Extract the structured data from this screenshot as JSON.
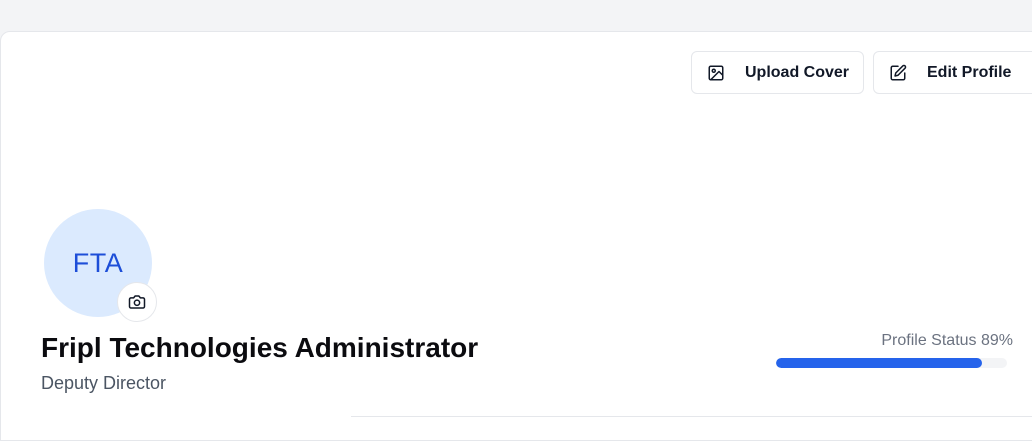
{
  "header": {
    "upload_cover_label": "Upload Cover",
    "edit_profile_label": "Edit Profile"
  },
  "profile": {
    "initials": "FTA",
    "name": "Fripl Technologies Administrator",
    "role": "Deputy Director"
  },
  "status": {
    "label": "Profile Status 89%",
    "progress_fraction": 0.89
  },
  "colors": {
    "accent": "#2563eb",
    "avatar_bg": "#dbeafe",
    "avatar_text": "#1d4ed8"
  },
  "icons": {
    "upload_cover": "image-icon",
    "edit_profile": "edit-icon",
    "change_avatar": "camera-icon"
  }
}
